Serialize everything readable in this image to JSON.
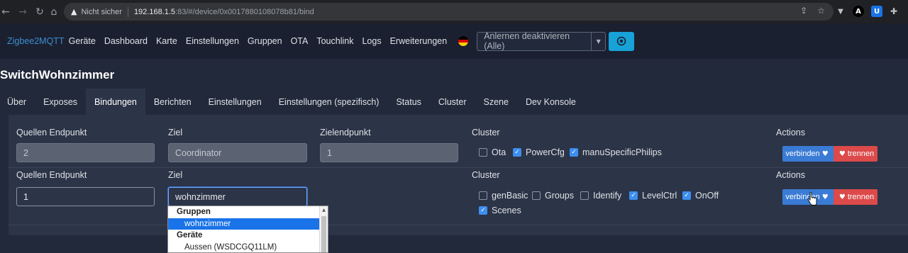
{
  "browser": {
    "back_icon": "arrow-left-icon",
    "security_label": "Nicht sicher",
    "url_host": "192.168.1.5",
    "url_path": ":83/#/device/0x0017880108078b81/bind"
  },
  "navbar": {
    "brand": "Zigbee2MQTT",
    "links": [
      "Geräte",
      "Dashboard",
      "Karte",
      "Einstellungen",
      "Gruppen",
      "OTA",
      "Touchlink",
      "Logs",
      "Erweiterungen"
    ],
    "permit_join": "Anlernen deaktivieren (Alle)"
  },
  "device": {
    "title": "SwitchWohnzimmer"
  },
  "tabs": [
    "Über",
    "Exposes",
    "Bindungen",
    "Berichten",
    "Einstellungen",
    "Einstellungen (spezifisch)",
    "Status",
    "Cluster",
    "Szene",
    "Dev Konsole"
  ],
  "active_tab": "Bindungen",
  "bindings": {
    "labels": {
      "source_endpoint": "Quellen Endpunkt",
      "target": "Ziel",
      "target_endpoint": "Zielendpunkt",
      "cluster": "Cluster",
      "actions": "Actions"
    },
    "rows": [
      {
        "source_endpoint": "2",
        "target": "Coordinator",
        "target_endpoint": "1",
        "clusters": [
          {
            "name": "Ota",
            "checked": false
          },
          {
            "name": "PowerCfg",
            "checked": true
          },
          {
            "name": "manuSpecificPhilips",
            "checked": true
          }
        ]
      },
      {
        "source_endpoint": "1",
        "target": "wohnzimmer",
        "clusters": [
          {
            "name": "genBasic",
            "checked": false
          },
          {
            "name": "Groups",
            "checked": false
          },
          {
            "name": "Identify",
            "checked": false
          },
          {
            "name": "LevelCtrl",
            "checked": true
          },
          {
            "name": "OnOff",
            "checked": true
          },
          {
            "name": "Scenes",
            "checked": true
          }
        ]
      }
    ],
    "bind_label": "verbinden",
    "unbind_label": "trennen"
  },
  "target_dropdown": {
    "groups_header": "Gruppen",
    "groups": [
      "wohnzimmer"
    ],
    "devices_header": "Geräte",
    "devices": [
      "Aussen (WSDCGQ11LM)"
    ]
  },
  "colors": {
    "accent": "#3e8ed0",
    "bind_button": "#3a7bd5",
    "unbind_button": "#dc4a4a",
    "permit_button": "#17a2d8"
  }
}
